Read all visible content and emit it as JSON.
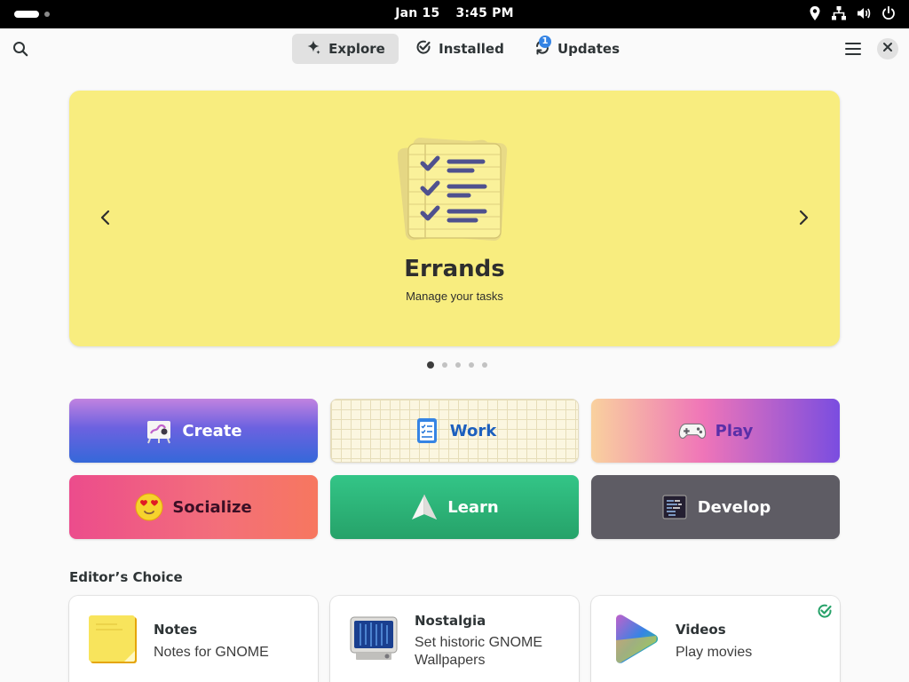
{
  "topbar": {
    "date": "Jan 15",
    "time": "3:45 PM",
    "icons": [
      "location-icon",
      "network-icon",
      "volume-icon",
      "power-icon"
    ]
  },
  "header": {
    "tabs": [
      {
        "label": "Explore",
        "icon": "sparkle-icon",
        "active": true
      },
      {
        "label": "Installed",
        "icon": "check-circle-icon",
        "active": false
      },
      {
        "label": "Updates",
        "icon": "refresh-icon",
        "active": false,
        "badge": "1"
      }
    ],
    "search_icon": "search-icon",
    "menu_icon": "hamburger-icon",
    "close_icon": "close-icon"
  },
  "featured": {
    "title": "Errands",
    "subtitle": "Manage your tasks",
    "background": "#f8ed7f",
    "page_count": 5,
    "active_page": 1
  },
  "categories": [
    {
      "label": "Create"
    },
    {
      "label": "Work"
    },
    {
      "label": "Play"
    },
    {
      "label": "Socialize"
    },
    {
      "label": "Learn"
    },
    {
      "label": "Develop"
    }
  ],
  "editors_choice": {
    "title": "Editor’s Choice",
    "apps": [
      {
        "name": "Notes",
        "desc": "Notes for GNOME",
        "installed": false
      },
      {
        "name": "Nostalgia",
        "desc": "Set historic GNOME Wallpapers",
        "installed": false
      },
      {
        "name": "Videos",
        "desc": "Play movies",
        "installed": true
      }
    ]
  },
  "colors": {
    "accent": "#3584e4",
    "installed_check": "#26a269"
  }
}
